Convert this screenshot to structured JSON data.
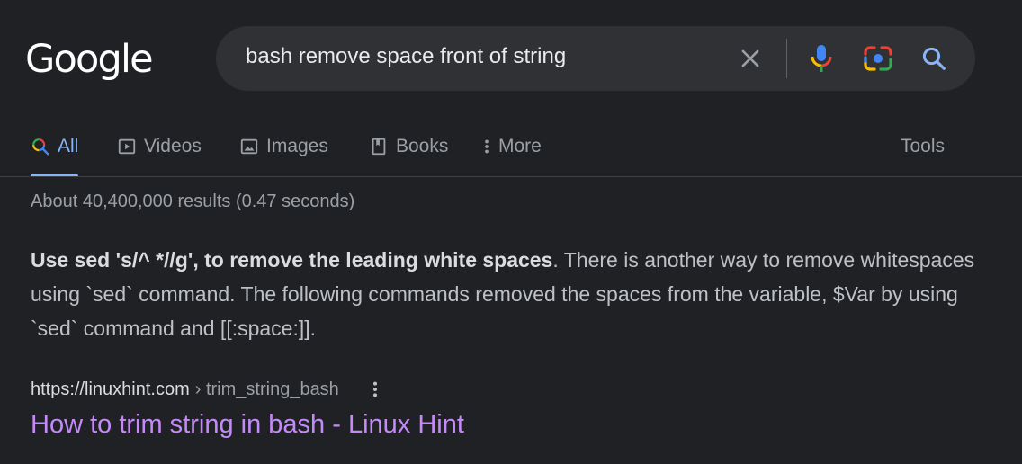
{
  "logo": {
    "text": "Google"
  },
  "search": {
    "query": "bash remove space front of string"
  },
  "tabs": [
    {
      "label": "All",
      "icon": "search-multicolor-icon",
      "active": true
    },
    {
      "label": "Videos",
      "icon": "play-icon"
    },
    {
      "label": "Images",
      "icon": "image-icon"
    },
    {
      "label": "Books",
      "icon": "book-icon"
    },
    {
      "label": "More",
      "icon": "vertical-dots-icon"
    }
  ],
  "tools": {
    "label": "Tools"
  },
  "stats": {
    "text": "About 40,400,000 results (0.47 seconds)"
  },
  "snippet": {
    "bold": "Use sed 's/^ *//g', to remove the leading white spaces",
    "rest": ". There is another way to remove whitespaces using `sed` command. The following commands removed the spaces from the variable, $Var by using `sed` command and [[:space:]]."
  },
  "result": {
    "domain": "https://linuxhint.com",
    "path": "› trim_string_bash",
    "title": "How to trim string in bash - Linux Hint"
  },
  "colors": {
    "background": "#202124",
    "link_visited": "#c58af9",
    "accent": "#8ab4f8"
  }
}
